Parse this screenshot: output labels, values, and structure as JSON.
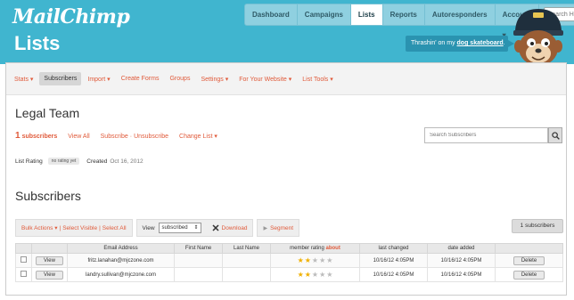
{
  "app": {
    "logo": "MailChimp",
    "page_heading": "Lists"
  },
  "topnav": {
    "tabs": [
      {
        "label": "Dashboard"
      },
      {
        "label": "Campaigns"
      },
      {
        "label": "Lists"
      },
      {
        "label": "Reports"
      },
      {
        "label": "Autoresponders"
      },
      {
        "label": "Account ▾"
      }
    ],
    "active_index": 2,
    "search_placeholder": "Search Help"
  },
  "promo": {
    "text": "Thrashin' on my",
    "link": "dog skateboard",
    "end": "."
  },
  "subnav": {
    "items": [
      "Stats ▾",
      "Subscribers",
      "Import ▾",
      "Create Forms",
      "Groups",
      "Settings ▾",
      "For Your Website ▾",
      "List Tools ▾"
    ],
    "active_index": 1
  },
  "list": {
    "name": "Legal Team",
    "subscriber_count": "1",
    "subscriber_count_label": "subscribers",
    "view_all": "View All",
    "subscribe": "Subscribe",
    "unsubscribe": "Unsubscribe",
    "change_list": "Change List ▾",
    "search_placeholder": "Search Subscribers",
    "rating_label": "List Rating",
    "rating_badge": "no rating yet",
    "created_label": "Created",
    "created_date": "Oct 16, 2012"
  },
  "subscribers": {
    "title": "Subscribers",
    "toolbar": {
      "bulk_actions": "Bulk Actions ▾",
      "select_visible": "Select Visible",
      "select_all": "Select All",
      "view_label": "View",
      "view_value": "subscribed",
      "download": "Download",
      "segment": "Segment"
    },
    "count_badge": "1 subscribers",
    "columns": {
      "email": "Email Address",
      "first": "First Name",
      "last": "Last Name",
      "rating": "member rating",
      "about": "about",
      "changed": "last changed",
      "added": "date added"
    },
    "rows": [
      {
        "view": "View",
        "email": "fritz.lanahan@mjczone.com",
        "first": "",
        "last": "",
        "rating": 2,
        "changed": "10/16/12 4:05PM",
        "added": "10/16/12 4:05PM",
        "delete": "Delete"
      },
      {
        "view": "View",
        "email": "landry.sullivan@mjczone.com",
        "first": "",
        "last": "",
        "rating": 2,
        "changed": "10/16/12 4:05PM",
        "added": "10/16/12 4:05PM",
        "delete": "Delete"
      }
    ]
  },
  "colors": {
    "header": "#40b5cf",
    "accent": "#e05a3a",
    "star": "#f0b000"
  }
}
